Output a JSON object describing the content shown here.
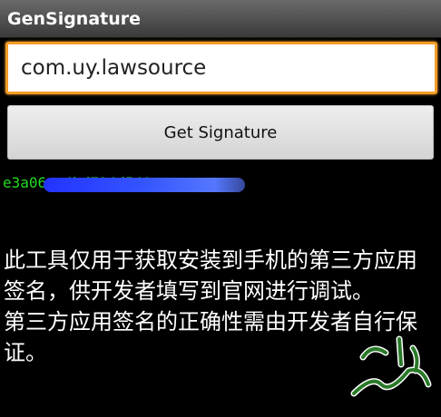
{
  "app": {
    "title": "GenSignature"
  },
  "form": {
    "package_value": "com.uy.lawsource",
    "button_label": "Get Signature"
  },
  "result": {
    "signature_visible": "e3a06                       c4bd724d540"
  },
  "description": {
    "line1": "此工具仅用于获取安装到手机的第三方应用签名，供开发者填写到官网进行调试。",
    "line2": "第三方应用签名的正确性需由开发者自行保证。"
  },
  "colors": {
    "accent": "#f39c27",
    "signature_text": "#22dd22",
    "background": "#000000"
  }
}
